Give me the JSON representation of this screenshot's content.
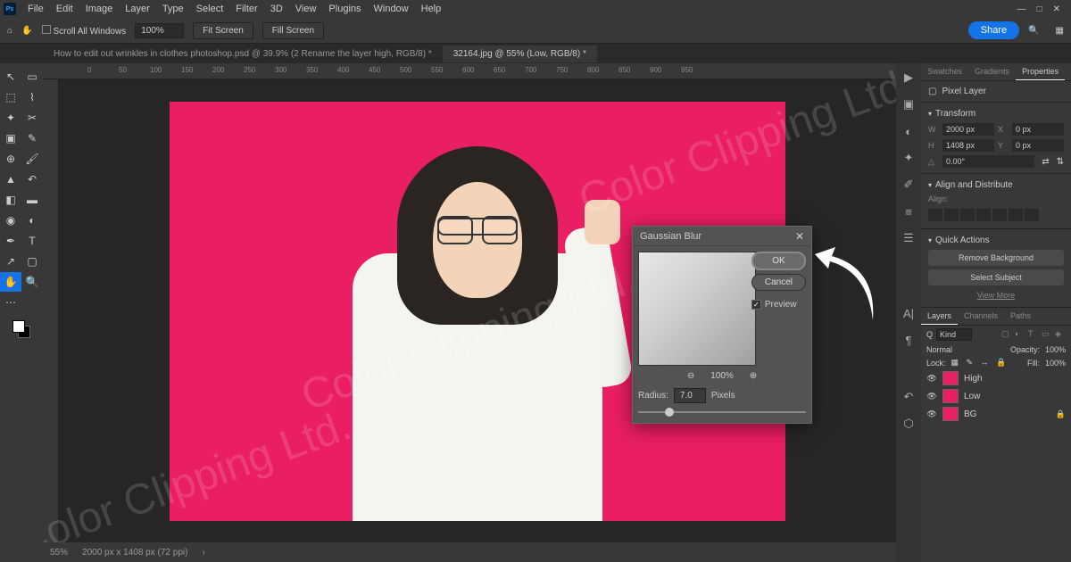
{
  "app_logo": "Ps",
  "menu": [
    "File",
    "Edit",
    "Image",
    "Layer",
    "Type",
    "Select",
    "Filter",
    "3D",
    "View",
    "Plugins",
    "Window",
    "Help"
  ],
  "options": {
    "scroll_all": "Scroll All Windows",
    "zoom_value": "100%",
    "fit_screen": "Fit Screen",
    "fill_screen": "Fill Screen"
  },
  "share": "Share",
  "tabs": {
    "tab1": "How to edit out wrinkles in clothes photoshop.psd @ 39.9% (2 Rename the layer high, RGB/8) *",
    "tab2": "32164.jpg @ 55% (Low, RGB/8) *"
  },
  "ruler_marks": [
    "0",
    "50",
    "100",
    "150",
    "200",
    "250",
    "300",
    "350",
    "400",
    "450",
    "500",
    "550",
    "600",
    "650",
    "700",
    "750",
    "800",
    "850",
    "900",
    "950"
  ],
  "status": {
    "zoom": "55%",
    "doc_info": "2000 px x 1408 px (72 ppi)"
  },
  "dialog": {
    "title": "Gaussian Blur",
    "ok": "OK",
    "cancel": "Cancel",
    "preview": "Preview",
    "zoom_pct": "100%",
    "radius_label": "Radius:",
    "radius_value": "7.0",
    "radius_unit": "Pixels"
  },
  "properties": {
    "tabs": [
      "Swatches",
      "Gradients",
      "Properties"
    ],
    "pixel_layer": "Pixel Layer",
    "transform": "Transform",
    "w": "2000 px",
    "h": "1408 px",
    "x": "0 px",
    "y": "0 px",
    "angle": "0.00°",
    "align_dist": "Align and Distribute",
    "align_label": "Align:",
    "quick_actions": "Quick Actions",
    "remove_bg": "Remove Background",
    "select_subject": "Select Subject",
    "view_more": "View More"
  },
  "layers": {
    "tabs": [
      "Layers",
      "Channels",
      "Paths"
    ],
    "kind": "Kind",
    "blend": "Normal",
    "opacity_label": "Opacity:",
    "opacity": "100%",
    "lock_label": "Lock:",
    "fill_label": "Fill:",
    "fill": "100%",
    "items": [
      {
        "name": "High"
      },
      {
        "name": "Low"
      },
      {
        "name": "BG"
      }
    ]
  },
  "watermark": "Color Clipping Ltd."
}
